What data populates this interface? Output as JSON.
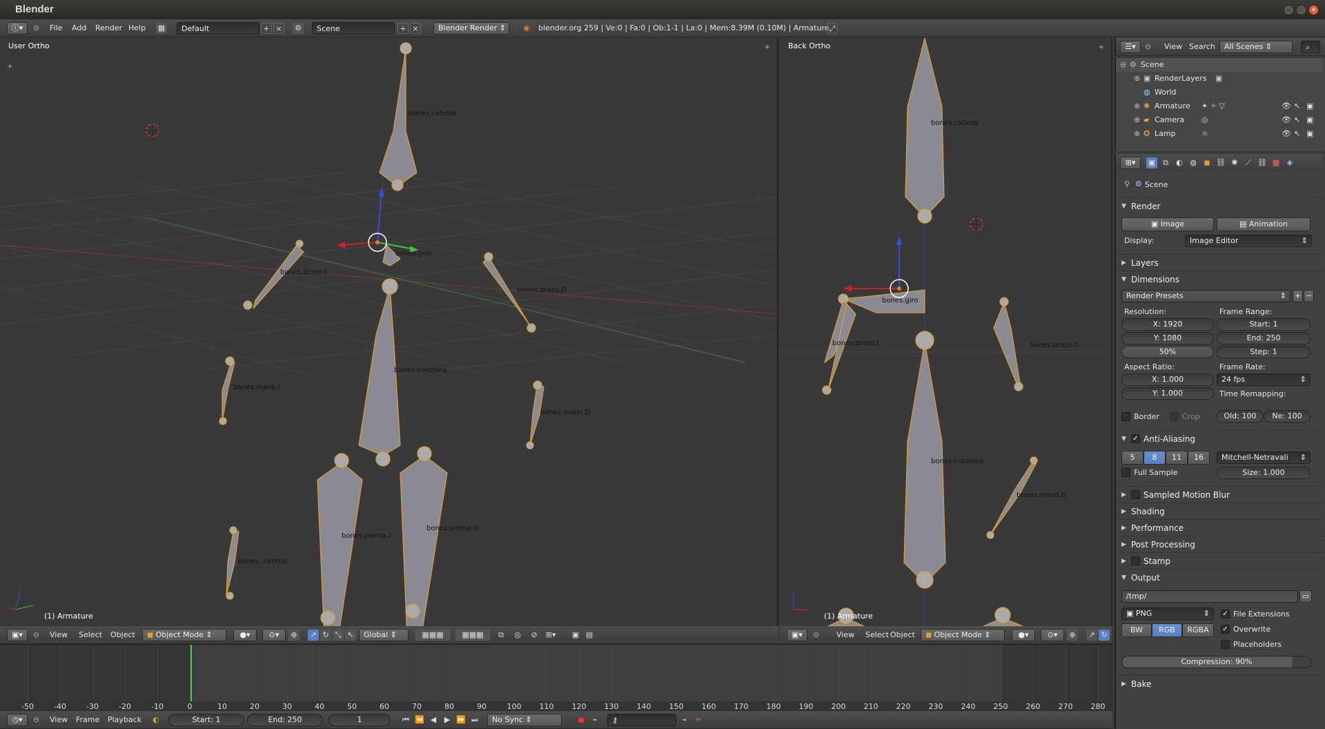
{
  "window": {
    "title": "Blender"
  },
  "info_header": {
    "menus": [
      "File",
      "Add",
      "Render",
      "Help"
    ],
    "layout": "Default",
    "scene": "Scene",
    "engine": "Blender Render",
    "stats": "blender.org 259 | Ve:0 | Fa:0 | Ob:1-1 | La:0 | Mem:8.39M (0.10M) | Armature"
  },
  "viewport_left": {
    "label": "User Ortho",
    "bones": [
      "bones.cabeza",
      "bones.giro",
      "bones.brazo.I",
      "bones.brazo.D",
      "bones.columna",
      "bones.mano.I",
      "bones.mano.D",
      "bones.pierna.I",
      "bones.pierna.D",
      "bones. control"
    ],
    "status": "(1) Armature"
  },
  "viewport_right": {
    "label": "Back Ortho",
    "bones": [
      "bones.cabeza",
      "bones.giro",
      "bones.brazo.I",
      "bones.brazo.D",
      "bones.columna",
      "bones.mano.D"
    ],
    "status": "(1) Armature"
  },
  "view3d_header": {
    "menus": [
      "View",
      "Select",
      "Object"
    ],
    "mode": "Object Mode",
    "orientation": "Global"
  },
  "outliner": {
    "menus": [
      "View",
      "Search"
    ],
    "filter": "All Scenes",
    "items": [
      "Scene",
      "RenderLayers",
      "World",
      "Armature",
      "Camera",
      "Lamp"
    ]
  },
  "properties": {
    "context": "Scene",
    "render_panel": "Render",
    "image_button": "Image",
    "animation_button": "Animation",
    "display_label": "Display:",
    "display_value": "Image Editor",
    "layers": "Layers",
    "dimensions": "Dimensions",
    "presets": "Render Presets",
    "resolution_label": "Resolution:",
    "res_x": "X: 1920",
    "res_y": "Y: 1080",
    "res_pct": "50%",
    "frame_range_label": "Frame Range:",
    "start": "Start: 1",
    "end": "End: 250",
    "step": "Step: 1",
    "aspect_label": "Aspect Ratio:",
    "asp_x": "X: 1.000",
    "asp_y": "Y: 1.000",
    "frame_rate_label": "Frame Rate:",
    "fps": "24 fps",
    "time_remap_label": "Time Remapping:",
    "old": "Old: 100",
    "new": "Ne: 100",
    "border": "Border",
    "crop": "Crop",
    "anti_aliasing": "Anti-Aliasing",
    "aa_samples": [
      "5",
      "8",
      "11",
      "16"
    ],
    "aa_filter": "Mitchell-Netravali",
    "full_sample": "Full Sample",
    "aa_size": "Size: 1.000",
    "sampled_motion_blur": "Sampled Motion Blur",
    "shading": "Shading",
    "performance": "Performance",
    "post_processing": "Post Processing",
    "stamp": "Stamp",
    "output": "Output",
    "output_path": "/tmp/",
    "format": "PNG",
    "file_extensions": "File Extensions",
    "overwrite": "Overwrite",
    "placeholders": "Placeholders",
    "color_modes": [
      "BW",
      "RGB",
      "RGBA"
    ],
    "compression": "Compression: 90%",
    "bake": "Bake"
  },
  "timeline": {
    "ticks": [
      "-50",
      "-40",
      "-30",
      "-20",
      "-10",
      "0",
      "10",
      "20",
      "30",
      "40",
      "50",
      "60",
      "70",
      "80",
      "90",
      "100",
      "110",
      "120",
      "130",
      "140",
      "150",
      "160",
      "170",
      "180",
      "190",
      "200",
      "210",
      "220",
      "230",
      "240",
      "250",
      "260",
      "270",
      "280"
    ],
    "menus": [
      "View",
      "Frame",
      "Playback"
    ],
    "start": "Start: 1",
    "end": "End: 250",
    "current": "1",
    "sync": "No Sync"
  },
  "colors": {
    "accent": "#5680c2",
    "bone_outline": "#e0a030",
    "x_axis": "#d02020",
    "y_axis": "#40c040",
    "z_axis": "#3050e0"
  }
}
